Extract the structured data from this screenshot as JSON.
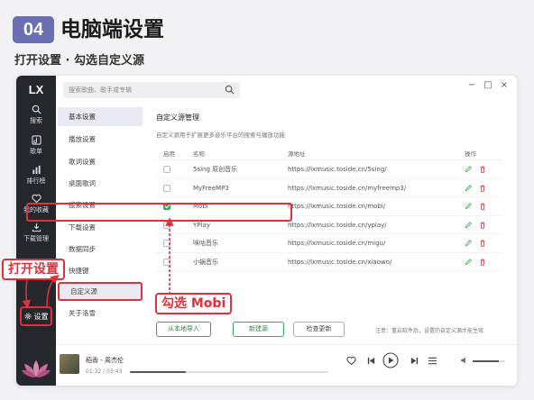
{
  "tutorial": {
    "step_number": "04",
    "title": "电脑端设置",
    "subtitle": "打开设置 · 勾选自定义源",
    "callout_settings": "打开设置",
    "callout_mobi": "勾选 Mobi"
  },
  "app": {
    "logo": "LX",
    "rail": [
      {
        "icon": "search-icon",
        "label": "搜索"
      },
      {
        "icon": "song-list-icon",
        "label": "歌单"
      },
      {
        "icon": "chart-icon",
        "label": "排行榜"
      },
      {
        "icon": "heart-icon",
        "label": "我的收藏"
      },
      {
        "icon": "download-icon",
        "label": "下载管理"
      }
    ],
    "settings_label": "设置",
    "search_placeholder": "搜索歌曲、歌手或专辑",
    "settings_nav": [
      "基本设置",
      "播放设置",
      "歌词设置",
      "桌面歌词",
      "搜索设置",
      "下载设置",
      "数据同步",
      "快捷键",
      "自定义源",
      "关于洛雪"
    ],
    "settings_nav_active": "自定义源",
    "content": {
      "title": "自定义源管理",
      "description": "自定义源用于扩展更多音乐平台的搜索与播放功能",
      "columns": [
        "启用",
        "名称",
        "源地址",
        "操作"
      ],
      "rows": [
        {
          "enabled": false,
          "name": "5sing 原创音乐",
          "url": "https://lxmusic.toside.cn/5sing/"
        },
        {
          "enabled": false,
          "name": "MyFreeMP3",
          "url": "https://lxmusic.toside.cn/myfreemp3/"
        },
        {
          "enabled": true,
          "name": "Mobi",
          "url": "https://lxmusic.toside.cn/mobi/"
        },
        {
          "enabled": false,
          "name": "YPlay",
          "url": "https://lxmusic.toside.cn/yplay/"
        },
        {
          "enabled": false,
          "name": "咪咕音乐",
          "url": "https://lxmusic.toside.cn/migu/"
        },
        {
          "enabled": false,
          "name": "小蜗音乐",
          "url": "https://lxmusic.toside.cn/xiaowo/"
        }
      ],
      "buttons": {
        "import": "从本地导入",
        "new": "新建源",
        "check": "检查更新"
      },
      "note": "注意：重启软件后，设置的自定义源才能生效"
    },
    "player": {
      "song": "稻香 - 周杰伦",
      "time": "01:32 / 03:43",
      "progress_fraction": 0.28
    },
    "colors": {
      "accent": "#e2303a",
      "green": "#3aa757",
      "badge": "#6b6fb1",
      "rail": "#26272c"
    }
  }
}
